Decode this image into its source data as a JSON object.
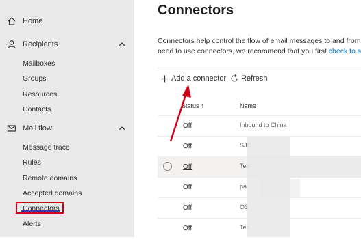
{
  "sidebar": {
    "home": "Home",
    "recipients": "Recipients",
    "recipients_items": [
      "Mailboxes",
      "Groups",
      "Resources",
      "Contacts"
    ],
    "mail_flow": "Mail flow",
    "mail_flow_items": [
      "Message trace",
      "Rules",
      "Remote domains",
      "Accepted domains",
      "Connectors",
      "Alerts"
    ]
  },
  "main": {
    "title": "Connectors",
    "description_line1": "Connectors help control the flow of email messages to and from you",
    "description_line2_prefix": "need to use connectors, we recommend that you first ",
    "description_link": "check to see if",
    "add_connector": "Add a connector",
    "refresh": "Refresh",
    "columns": {
      "status": "Status",
      "name": "Name"
    },
    "rows": [
      {
        "status": "Off",
        "name": "Inbound to China"
      },
      {
        "status": "Off",
        "name": "SJC"
      },
      {
        "status": "Off",
        "name": "Tes"
      },
      {
        "status": "Off",
        "name": "pa"
      },
      {
        "status": "Off",
        "name": "O3"
      },
      {
        "status": "Off",
        "name": "Tes"
      }
    ]
  },
  "colors": {
    "accent": "#0078d4",
    "annotation": "#d0021b",
    "sidebar_bg": "#e9e9e9"
  }
}
